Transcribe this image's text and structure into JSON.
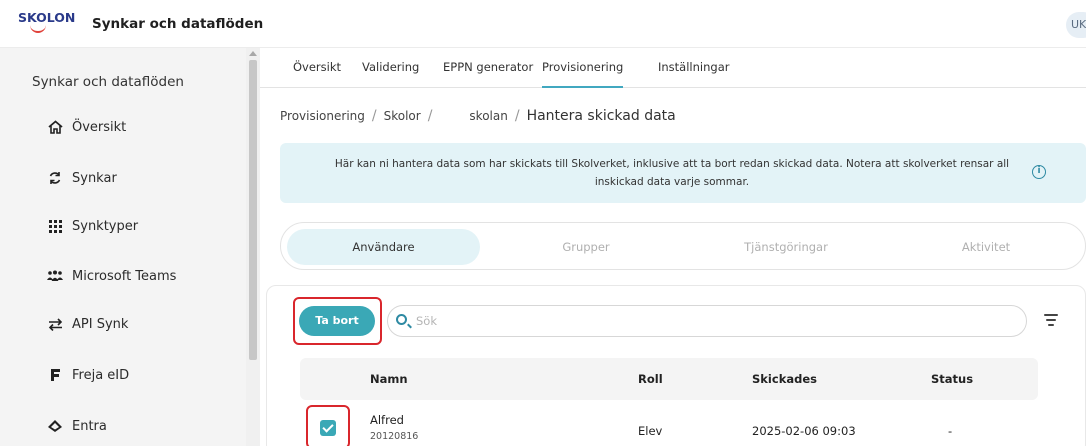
{
  "header": {
    "logo": "SKOLON",
    "title": "Synkar och dataflöden",
    "user_initials": "UK"
  },
  "sidebar": {
    "title": "Synkar och dataflöden",
    "items": [
      {
        "label": "Översikt",
        "icon": "home-icon"
      },
      {
        "label": "Synkar",
        "icon": "sync-icon"
      },
      {
        "label": "Synktyper",
        "icon": "grid-icon"
      },
      {
        "label": "Microsoft Teams",
        "icon": "teams-icon"
      },
      {
        "label": "API Synk",
        "icon": "swap-arrows-icon"
      },
      {
        "label": "Freja eID",
        "icon": "freja-icon"
      },
      {
        "label": "Entra",
        "icon": "entra-icon"
      }
    ]
  },
  "tabs": [
    {
      "label": "Översikt"
    },
    {
      "label": "Validering"
    },
    {
      "label": "EPPN generator"
    },
    {
      "label": "Provisionering",
      "active": true
    },
    {
      "label": "Inställningar"
    }
  ],
  "breadcrumb": {
    "items": [
      "Provisionering",
      "Skolor",
      "skolan"
    ],
    "current": "Hantera skickad data"
  },
  "info": {
    "text": "Här kan ni hantera data som har skickats till Skolverket, inklusive att ta bort redan skickad data. Notera att skolverket rensar all inskickad data varje sommar."
  },
  "segments": [
    {
      "label": "Användare",
      "active": true
    },
    {
      "label": "Grupper"
    },
    {
      "label": "Tjänstgöringar"
    },
    {
      "label": "Aktivitet"
    }
  ],
  "toolbar": {
    "delete_label": "Ta bort",
    "search_placeholder": "Sök",
    "search_value": ""
  },
  "table": {
    "columns": [
      "Namn",
      "Roll",
      "Skickades",
      "Status"
    ],
    "rows": [
      {
        "name": "Alfred",
        "id": "20120816",
        "role": "Elev",
        "sent": "2025-02-06 09:03",
        "status": "-",
        "checked": true
      }
    ]
  },
  "colors": {
    "accent": "#3aa8b6",
    "highlight": "#d9262c",
    "info_bg": "#e3f3f7"
  }
}
